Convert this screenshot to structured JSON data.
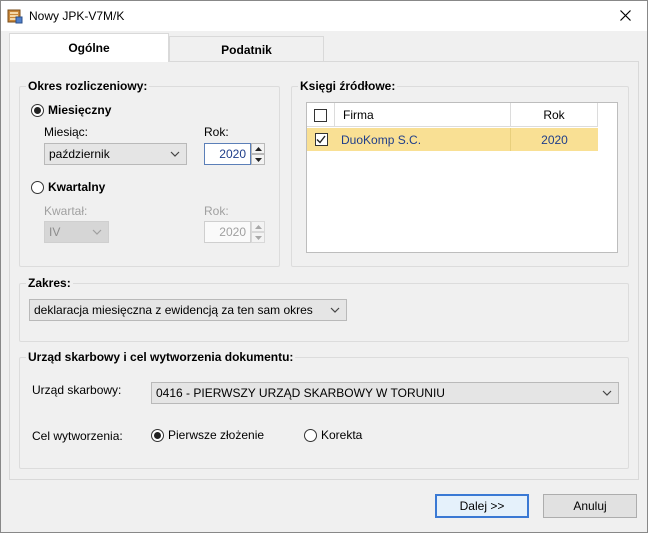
{
  "window": {
    "title": "Nowy JPK-V7M/K"
  },
  "tabs": [
    {
      "label": "Ogólne"
    },
    {
      "label": "Podatnik"
    }
  ],
  "okres": {
    "title": "Okres rozliczeniowy:",
    "miesieczny": {
      "label": "Miesięczny",
      "checked": true,
      "month_label": "Miesiąc:",
      "month_value": "październik",
      "year_label": "Rok:",
      "year_value": "2020"
    },
    "kwartalny": {
      "label": "Kwartalny",
      "checked": false,
      "quarter_label": "Kwartał:",
      "quarter_value": "IV",
      "year_label": "Rok:",
      "year_value": "2020"
    }
  },
  "ksiegi": {
    "title": "Księgi źródłowe:",
    "columns": [
      "Firma",
      "Rok"
    ],
    "rows": [
      {
        "checked": true,
        "firma": "DuoKomp S.C.",
        "rok": "2020"
      }
    ],
    "highlight_color": "#f9e094"
  },
  "zakres": {
    "title": "Zakres:",
    "value": "deklaracja miesięczna z ewidencją za ten sam okres"
  },
  "urzad": {
    "title": "Urząd skarbowy i cel wytworzenia dokumentu:",
    "office_label": "Urząd skarbowy:",
    "office_value": "0416 - PIERWSZY URZĄD SKARBOWY W TORUNIU",
    "purpose_label": "Cel wytworzenia:",
    "purpose_options": [
      {
        "label": "Pierwsze złożenie",
        "checked": true
      },
      {
        "label": "Korekta",
        "checked": false
      }
    ]
  },
  "buttons": {
    "next": "Dalej >>",
    "cancel": "Anuluj"
  },
  "icons": {
    "app": "jpk-app-icon",
    "close": "close-icon"
  }
}
